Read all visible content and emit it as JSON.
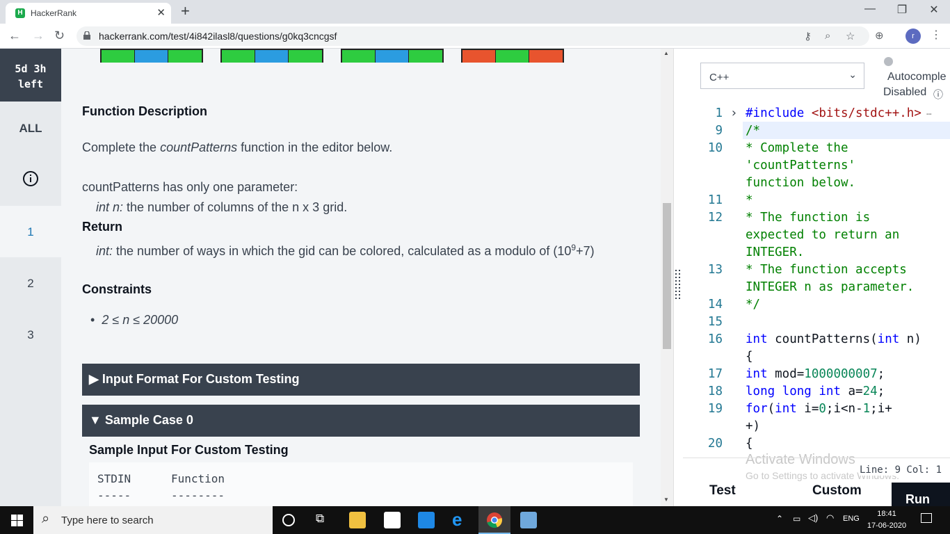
{
  "browser": {
    "tab_title": "HackerRank",
    "url": "hackerrank.com/test/4i842ilasl8/questions/g0kq3cncgsf",
    "profile_initial": "r"
  },
  "sidebar": {
    "timer_line1": "5d 3h",
    "timer_line2": "left",
    "all_label": "ALL",
    "info_icon": "info-icon",
    "questions": [
      "1",
      "2",
      "3"
    ]
  },
  "problem": {
    "function_description_heading": "Function Description",
    "complete_prefix": "Complete the ",
    "complete_fn": "countPatterns",
    "complete_suffix": " function in the editor below.",
    "param_intro": "countPatterns has only one parameter:",
    "param_type": "int n:",
    "param_desc": " the number of columns of the n x 3 grid.",
    "return_heading": "Return",
    "return_type": "int:",
    "return_desc": " the number of ways in which the gid can be colored, calculated as a modulo of (10",
    "return_exp": "9",
    "return_tail": "+7)",
    "constraints_heading": "Constraints",
    "constraint": "2 ≤ n ≤ 20000",
    "input_format_bar": "Input Format For Custom Testing",
    "sample_case_bar": "Sample Case 0",
    "sample_input_heading": "Sample Input For Custom Testing",
    "stdin_col": "STDIN",
    "function_col": "Function",
    "stdin_dash": "-----",
    "function_dash": "--------"
  },
  "editor": {
    "language": "C++",
    "autocomplete_line1": "Autocomple",
    "autocomplete_line2": "Disabled",
    "status": "Line: 9 Col: 1",
    "watermark_title": "Activate Windows",
    "watermark_sub": "Go to Settings to activate Windows.",
    "test_label": "Test",
    "custom_label": "Custom",
    "run_label": "Run",
    "line_numbers": [
      "1",
      "9",
      "10",
      "11",
      "12",
      "13",
      "14",
      "15",
      "16",
      "17",
      "18",
      "19",
      "20"
    ]
  },
  "taskbar": {
    "search_placeholder": "Type here to search",
    "language": "ENG",
    "time": "18:41",
    "date": "17-06-2020"
  },
  "colors": {
    "green": "#2ecc40",
    "blue": "#2b9ce0",
    "red": "#e8542e",
    "dark_bar": "#39424e"
  }
}
